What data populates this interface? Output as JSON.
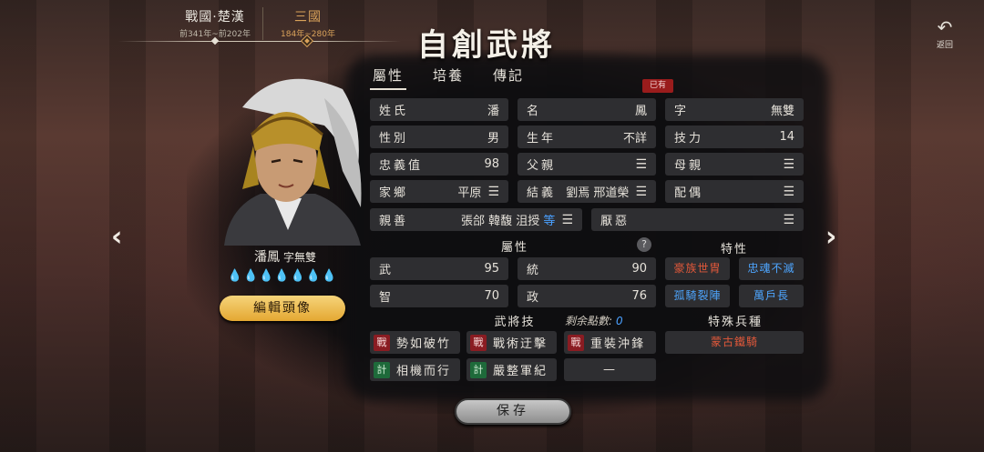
{
  "eras": [
    {
      "name": "戰國·楚漢",
      "range": "前341年~前202年"
    },
    {
      "name": "三國",
      "range": "184年~280年"
    }
  ],
  "title": "自創武將",
  "back_label": "返回",
  "icons": {
    "back": "back-arrow-icon",
    "left": "chevron-left-icon",
    "right": "chevron-right-icon",
    "menu": "menu-icon",
    "help": "question-icon",
    "drop": "water-drop-icon"
  },
  "portrait": {
    "name": "潘鳳",
    "courtesy": "字無雙",
    "drops": "💧💧💧💧💧💧💧",
    "edit_label": "編輯頭像"
  },
  "tabs": [
    "屬性",
    "培養",
    "傳記"
  ],
  "badge": "已有",
  "fields": {
    "surname": {
      "k": "姓氏",
      "v": "潘"
    },
    "given": {
      "k": "名",
      "v": "鳳"
    },
    "zi": {
      "k": "字",
      "v": "無雙"
    },
    "gender": {
      "k": "性別",
      "v": "男"
    },
    "birth": {
      "k": "生年",
      "v": "不詳"
    },
    "skill": {
      "k": "技力",
      "v": "14"
    },
    "loyalty": {
      "k": "忠義值",
      "v": "98"
    },
    "father": {
      "k": "父親",
      "v": ""
    },
    "mother": {
      "k": "母親",
      "v": ""
    },
    "home": {
      "k": "家鄉",
      "v": "平原"
    },
    "sworn": {
      "k": "結義",
      "v": "劉焉 邢道榮"
    },
    "spouse": {
      "k": "配偶",
      "v": ""
    },
    "friend": {
      "k": "親善",
      "v": "張郃 韓馥 沮授",
      "more": "等"
    },
    "hate": {
      "k": "厭惡",
      "v": ""
    }
  },
  "attr": {
    "heading": "屬性",
    "wu": {
      "k": "武",
      "v": "95"
    },
    "tong": {
      "k": "統",
      "v": "90"
    },
    "zhi": {
      "k": "智",
      "v": "70"
    },
    "zheng": {
      "k": "政",
      "v": "76"
    }
  },
  "traits": {
    "heading": "特性",
    "items": [
      "豪族世胄",
      "忠魂不滅",
      "孤騎裂陣",
      "萬戶長"
    ]
  },
  "skills": {
    "heading": "武將技",
    "points_label": "剩余點數:",
    "points": "0",
    "items": [
      {
        "tag": "戰",
        "name": "勢如破竹"
      },
      {
        "tag": "戰",
        "name": "戰術迂擊"
      },
      {
        "tag": "戰",
        "name": "重裝沖鋒"
      },
      {
        "tag": "計",
        "name": "相機而行"
      },
      {
        "tag": "計",
        "name": "嚴整軍紀"
      }
    ],
    "empty": "—"
  },
  "troops": {
    "heading": "特殊兵種",
    "item": "蒙古鐵騎"
  },
  "save_label": "保存",
  "colors": {
    "accent": "#d9a25a",
    "red": "#e0583a",
    "blue": "#4aa0ff",
    "button_gold": "#f6d47a"
  }
}
